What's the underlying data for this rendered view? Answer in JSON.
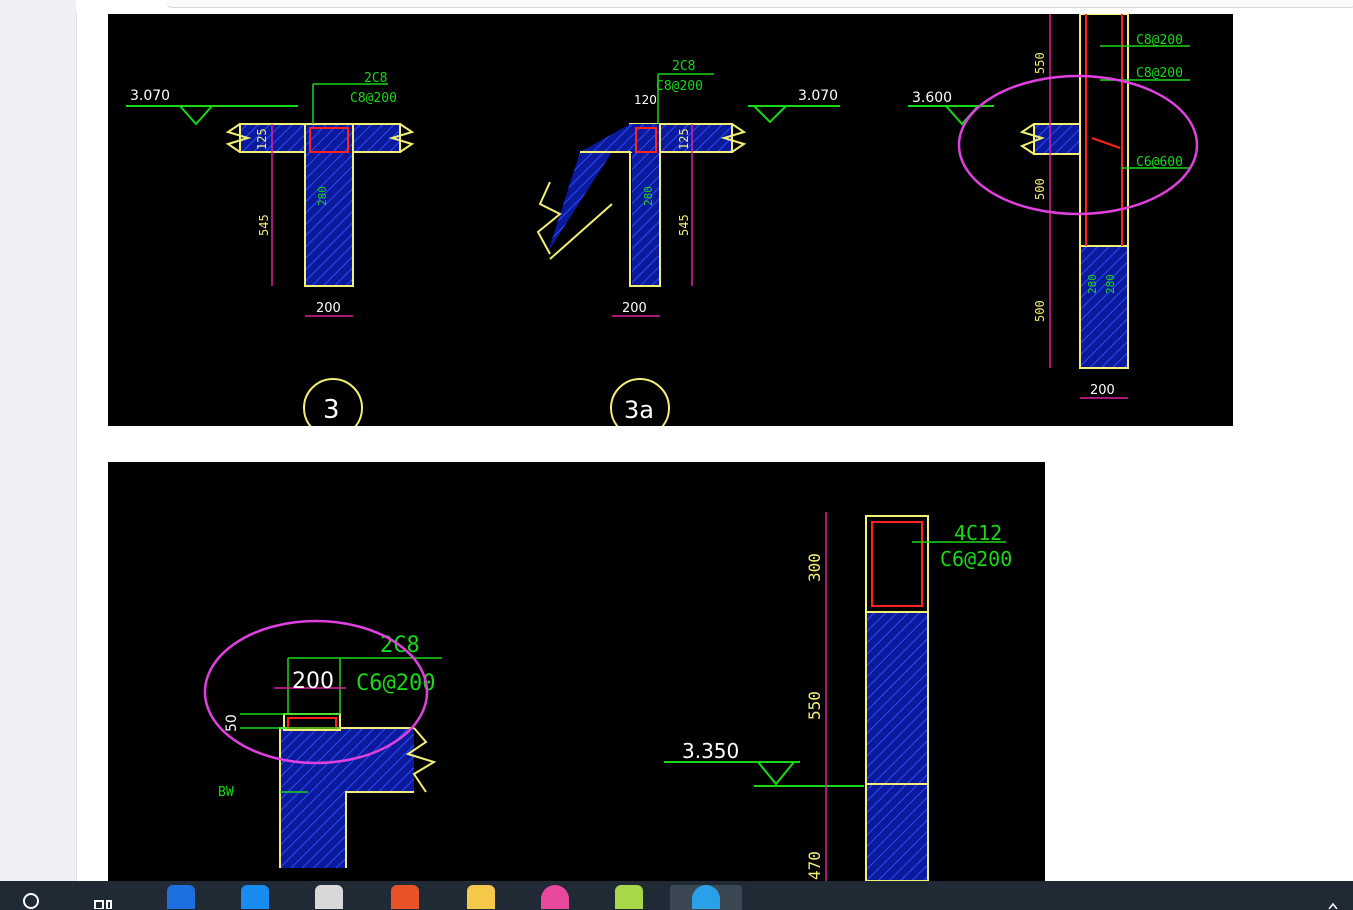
{
  "drawing_top": {
    "level_left": "3.070",
    "level_mid": "3.070",
    "level_right": "3.600",
    "rebar_2c8_a": "2C8",
    "rebar_c8_a": "C8@200",
    "rebar_2c8_b": "2C8",
    "rebar_c8_b": "C8@200",
    "dim_125_a": "125",
    "dim_545_a": "545",
    "dim_280_a": "280",
    "dim_200_a": "200",
    "dim_120": "120",
    "dim_125_b": "125",
    "dim_545_b": "545",
    "dim_280_b": "280",
    "dim_200_b": "200",
    "label_3": "3",
    "label_3a": "3a",
    "col_c8_1": "C8@200",
    "col_c8_2": "C8@200",
    "col_c6": "C6@600",
    "col_dim_550": "550",
    "col_dim_500_a": "500",
    "col_dim_500_b": "500",
    "col_dim_280_a": "280",
    "col_dim_280_b": "280",
    "col_dim_200": "200"
  },
  "drawing_bottom": {
    "rebar_2c8": "2C8",
    "dim_200": "200",
    "rebar_c6": "C6@200",
    "dim_50": "50",
    "label_bw": "BW",
    "level": "3.350",
    "col_rebar_4c12": "4C12",
    "col_rebar_c6": "C6@200",
    "col_dim_300": "300",
    "col_dim_550": "550",
    "col_dim_470": "470"
  },
  "taskbar": {
    "colors": {
      "search": "#ffffff",
      "taskview": "#ffffff",
      "app1": "#1e6fe0",
      "app2": "#1a8cf0",
      "app3": "#d8d8d8",
      "app4": "#e8532a",
      "app5": "#f5c84c",
      "app6": "#e8489c",
      "app7": "#a8d84a",
      "app8": "#2aa0e8"
    }
  }
}
